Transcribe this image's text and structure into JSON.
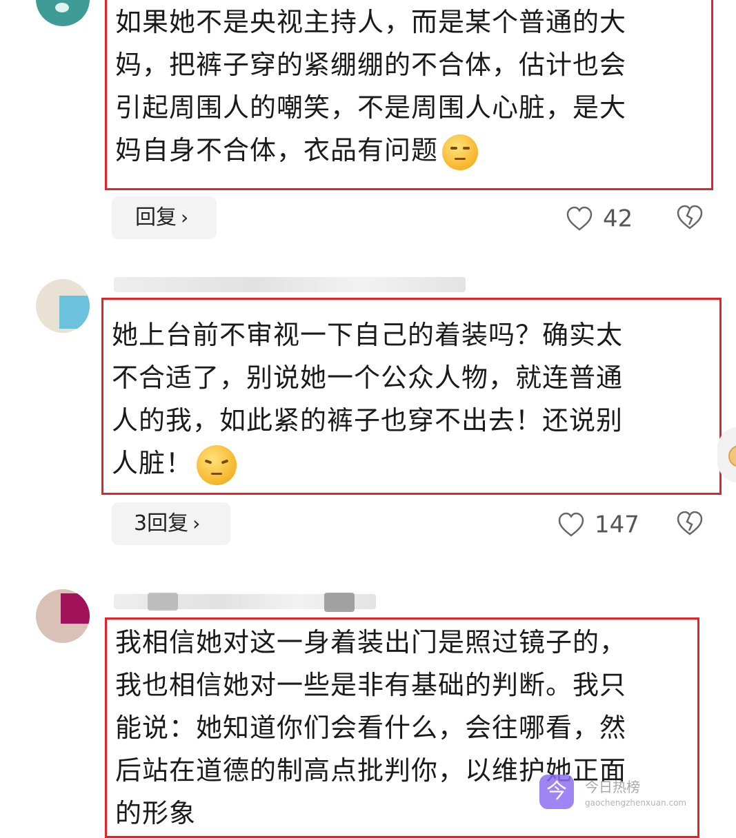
{
  "comments": [
    {
      "text": "如果她不是央视主持人，而是某个普通的大\n妈，把裤子穿的紧绷绷的不合体，估计也会\n引起周围人的嘲笑，不是周围人心脏，是大\n妈自身不合体，衣品有问题",
      "emoji_icon": "thinking-smirk-emoji",
      "reply_label": "回复",
      "likes": "42"
    },
    {
      "text": "她上台前不审视一下自己的着装吗？确实太\n不合适了，别说她一个公众人物，就连普通\n人的我，如此紧的裤子也穿不出去！还说别\n人脏！",
      "emoji_icon": "angry-face-emoji",
      "reply_label": "3回复",
      "likes": "147"
    },
    {
      "text": "我相信她对这一身着装出门是照过镜子的，\n我也相信她对一些是非有基础的判断。我只\n能说：她知道你们会看什么，会往哪看，然\n后站在道德的制高点批判你，以维护她正面\n的形象"
    }
  ],
  "watermark": {
    "name": "今日热榜",
    "url": "gaochengzhenxuan.com",
    "logo_char": "今"
  },
  "colors": {
    "highlight_border": "#e0242a",
    "reply_bg": "#f3f3f3"
  }
}
